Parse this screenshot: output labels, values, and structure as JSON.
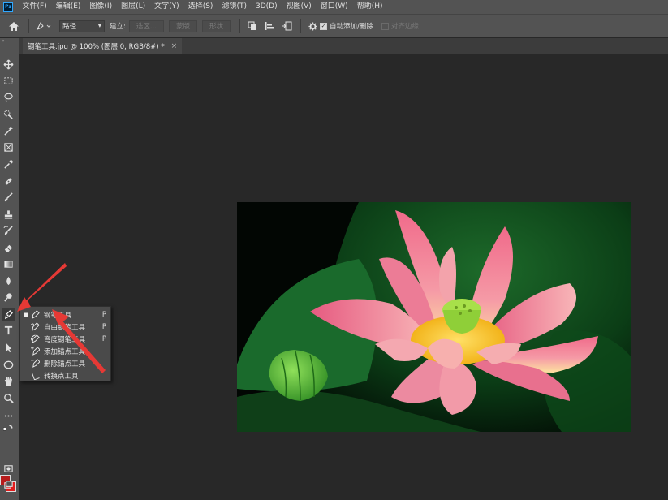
{
  "app": {
    "logo": "Ps"
  },
  "menu": [
    "文件(F)",
    "编辑(E)",
    "图像(I)",
    "图层(L)",
    "文字(Y)",
    "选择(S)",
    "滤镜(T)",
    "3D(D)",
    "视图(V)",
    "窗口(W)",
    "帮助(H)"
  ],
  "options": {
    "mode_value": "路径",
    "make_label": "建立:",
    "selection_btn": "选区...",
    "mask_btn": "蒙版",
    "shape_btn": "形状",
    "auto_add_delete_label": "自动添加/删除",
    "align_edges_label": "对齐边缘",
    "auto_add_delete_checked": true,
    "align_edges_checked": false
  },
  "document": {
    "tab_title": "钢笔工具.jpg @ 100% (图层 0, RGB/8#) *",
    "close_glyph": "×"
  },
  "toolbar": {
    "collapse_glyph": "»",
    "foreground_color": "#b71c1c",
    "background_color": "#e21d1d"
  },
  "flyout": {
    "items": [
      {
        "label": "钢笔工具",
        "shortcut": "P",
        "selected": true,
        "icon": "pen-icon"
      },
      {
        "label": "自由钢笔工具",
        "shortcut": "P",
        "selected": false,
        "icon": "freeform-pen-icon"
      },
      {
        "label": "弯度钢笔工具",
        "shortcut": "P",
        "selected": false,
        "icon": "curvature-pen-icon"
      },
      {
        "label": "添加锚点工具",
        "shortcut": "",
        "selected": false,
        "icon": "add-anchor-icon"
      },
      {
        "label": "删除锚点工具",
        "shortcut": "",
        "selected": false,
        "icon": "delete-anchor-icon"
      },
      {
        "label": "转换点工具",
        "shortcut": "",
        "selected": false,
        "icon": "convert-point-icon"
      }
    ]
  },
  "annotation_color": "#e53935"
}
